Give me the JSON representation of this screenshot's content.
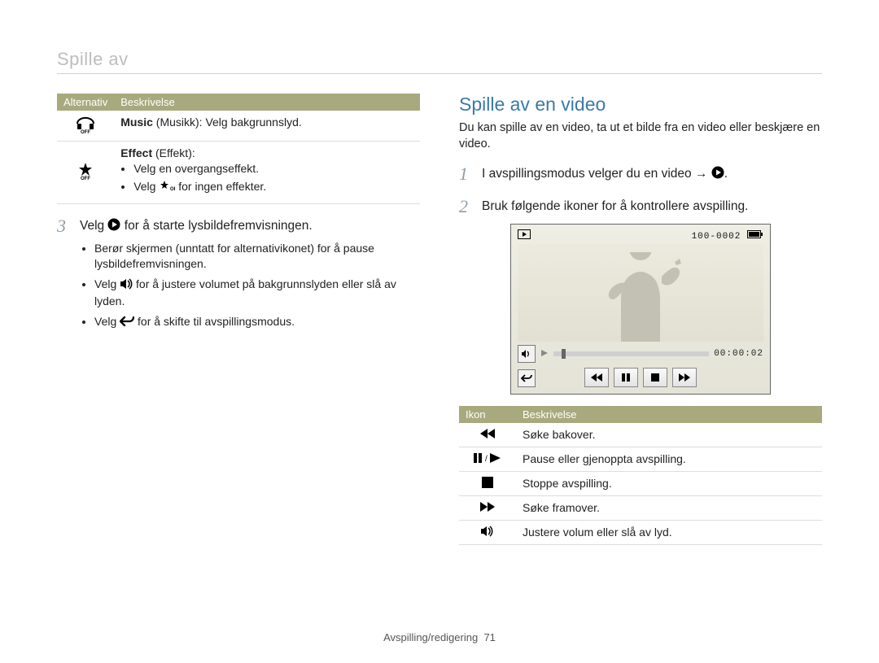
{
  "running_head": "Spille av",
  "left": {
    "table": {
      "headers": {
        "col1": "Alternativ",
        "col2": "Beskrivelse"
      },
      "rows": [
        {
          "icon": "headphones-off-icon",
          "strong": "Music",
          "paren": " (Musikk): Velg bakgrunnslyd."
        },
        {
          "icon": "sparkle-off-icon",
          "line1_strong": "Effect",
          "line1_paren": " (Effekt):",
          "bullets": [
            "Velg en overgangseffekt.",
            "Velg   for ingen effekter."
          ],
          "bullet1_icon_label": "sparkle-off"
        }
      ]
    },
    "step3": {
      "num": "3",
      "main_a": "Velg ",
      "main_b": " for å starte lysbildefremvisningen.",
      "bullets": [
        "Berør skjermen (unntatt for alternativikonet) for å pause lysbildefremvisningen.",
        {
          "pre": "Velg ",
          "post": " for å justere volumet på bakgrunnslyden eller slå av lyden.",
          "icon": "speaker-icon"
        },
        {
          "pre": "Velg ",
          "post": " for å skifte til avspillingsmodus.",
          "icon": "return-icon"
        }
      ]
    }
  },
  "right": {
    "title": "Spille av en video",
    "intro": "Du kan spille av en video, ta ut et bilde fra en video eller beskjære en video.",
    "step1": {
      "num": "1",
      "text_a": "I avspillingsmodus velger du en video → ",
      "icon": "play-disc-icon"
    },
    "step2": {
      "num": "2",
      "text": "Bruk følgende ikoner for å kontrollere avspilling."
    },
    "player": {
      "file_label": "100-0002",
      "time": "00:00:02"
    },
    "icon_table": {
      "headers": {
        "col1": "Ikon",
        "col2": "Beskrivelse"
      },
      "rows": [
        {
          "icon": "rewind-icon",
          "desc": "Søke bakover."
        },
        {
          "icon": "pause-play-icon",
          "desc": "Pause eller gjenoppta avspilling."
        },
        {
          "icon": "stop-icon",
          "desc": "Stoppe avspilling."
        },
        {
          "icon": "fast-forward-icon",
          "desc": "Søke framover."
        },
        {
          "icon": "speaker-icon",
          "desc": "Justere volum eller slå av lyd."
        }
      ]
    }
  },
  "footer": {
    "section": "Avspilling/redigering",
    "page": "71"
  }
}
